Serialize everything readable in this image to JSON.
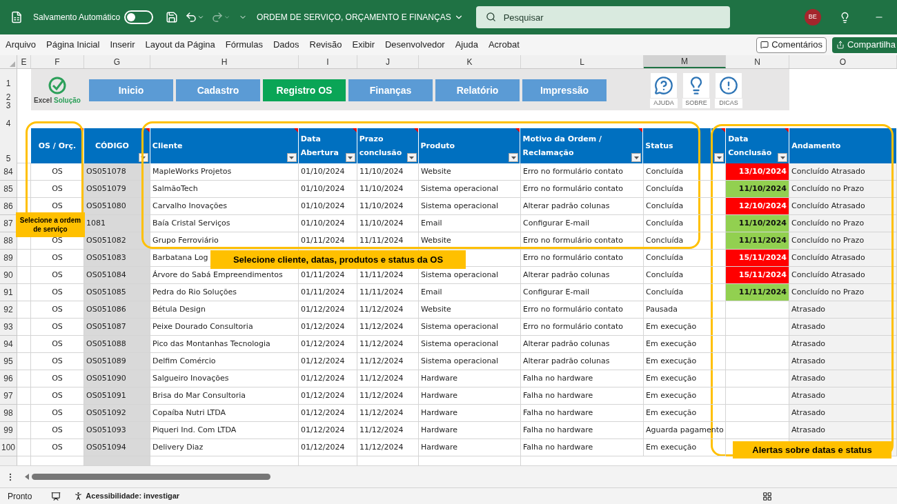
{
  "title_bar": {
    "autosave_label": "Salvamento Automático",
    "autosave_on": false,
    "document_title": "ORDEM DE SERVIÇO, ORÇAMENTO E FINANÇAS",
    "search_placeholder": "Pesquisar",
    "user_initials": "BE"
  },
  "menu": {
    "tabs": [
      "Arquivo",
      "Página Inicial",
      "Inserir",
      "Layout da Página",
      "Fórmulas",
      "Dados",
      "Revisão",
      "Exibir",
      "Desenvolvedor",
      "Ajuda",
      "Acrobat"
    ],
    "comments_button": "Comentários",
    "share_button": "Compartilha"
  },
  "column_headers": [
    {
      "label": "E",
      "selected": false
    },
    {
      "label": "F",
      "selected": false
    },
    {
      "label": "G",
      "selected": false
    },
    {
      "label": "H",
      "selected": false
    },
    {
      "label": "I",
      "selected": false
    },
    {
      "label": "J",
      "selected": false
    },
    {
      "label": "K",
      "selected": false
    },
    {
      "label": "L",
      "selected": false
    },
    {
      "label": "M",
      "selected": true
    },
    {
      "label": "N",
      "selected": false
    },
    {
      "label": "O",
      "selected": false
    }
  ],
  "top_row_numbers": [
    "1",
    "2",
    "3",
    "4",
    "5"
  ],
  "logo": {
    "word_1": "Excel",
    "word_2": "Solução"
  },
  "nav_buttons": [
    {
      "label": "Inicio",
      "selected": false
    },
    {
      "label": "Cadastro",
      "selected": false
    },
    {
      "label": "Registro OS",
      "selected": true
    },
    {
      "label": "Finanças",
      "selected": false
    },
    {
      "label": "Relatório",
      "selected": false
    },
    {
      "label": "Impressão",
      "selected": false
    }
  ],
  "info_buttons": [
    {
      "kind": "help",
      "label": "AJUDA"
    },
    {
      "kind": "about",
      "label": "SOBRE"
    },
    {
      "kind": "tips",
      "label": "DICAS"
    }
  ],
  "table": {
    "columns": [
      {
        "label": "OS / Orç.",
        "filter": false,
        "comment": true
      },
      {
        "label": "CÓDIGO",
        "filter": true,
        "comment": true
      },
      {
        "label": "Cliente",
        "filter": true,
        "comment": true
      },
      {
        "label": "Data Abertura",
        "filter": true,
        "comment": true
      },
      {
        "label": "Prazo conclusão",
        "filter": true,
        "comment": true
      },
      {
        "label": "Produto",
        "filter": true,
        "comment": true
      },
      {
        "label": "Motivo da Ordem / Reclamação",
        "filter": true,
        "comment": true
      },
      {
        "label": "Status",
        "filter": false,
        "comment": false
      },
      {
        "filter": true,
        "comment": true
      },
      {
        "label": "Data Conclusão",
        "filter": true,
        "comment": true
      },
      {
        "label": "Andamento",
        "filter": false,
        "comment": false
      }
    ],
    "rows": [
      {
        "row_number": "84",
        "type": "OS",
        "code": "OS051078",
        "client": "MapleWorks Projetos",
        "opened": "01/10/2024",
        "deadline": "11/10/2024",
        "product": "Website",
        "reason": "Erro no formulário contato",
        "status": "Concluída",
        "completed": "13/10/2024",
        "color": "#ff0000",
        "progress": "Concluído Atrasado"
      },
      {
        "row_number": "85",
        "type": "OS",
        "code": "OS051079",
        "client": "SalmãoTech",
        "opened": "01/10/2024",
        "deadline": "11/10/2024",
        "product": "Sistema operacional",
        "reason": "Erro no formulário contato",
        "status": "Concluída",
        "completed": "11/10/2024",
        "color": "#92d050",
        "progress": "Concluído no Prazo"
      },
      {
        "row_number": "86",
        "type": "OS",
        "code": "OS051080",
        "client": "Carvalho Inovações",
        "opened": "01/10/2024",
        "deadline": "11/10/2024",
        "product": "Sistema operacional",
        "reason": "Alterar padrão colunas",
        "status": "Concluída",
        "completed": "12/10/2024",
        "color": "#ff0000",
        "progress": "Concluído Atrasado"
      },
      {
        "row_number": "87",
        "code": "1081",
        "client": "Baía Cristal Serviços",
        "opened": "01/10/2024",
        "deadline": "11/10/2024",
        "product": "Email",
        "reason": "Configurar E-mail",
        "status": "Concluída",
        "completed": "11/10/2024",
        "color": "#92d050",
        "progress": "Concluído no Prazo"
      },
      {
        "row_number": "88",
        "type": "OS",
        "code": "OS051082",
        "client": "Grupo Ferroviário",
        "opened": "01/11/2024",
        "deadline": "11/11/2024",
        "product": "Website",
        "reason": "Erro no formulário contato",
        "status": "Concluída",
        "completed": "11/11/2024",
        "color": "#92d050",
        "progress": "Concluído no Prazo"
      },
      {
        "row_number": "89",
        "type": "OS",
        "code": "OS051083",
        "client": "Barbatana Log",
        "reason": "Erro no formulário contato",
        "status": "Concluída",
        "completed": "15/11/2024",
        "color": "#ff0000",
        "progress": "Concluído Atrasado"
      },
      {
        "row_number": "90",
        "type": "OS",
        "code": "OS051084",
        "client": "Árvore do Sabá Empreendimentos",
        "opened": "01/11/2024",
        "deadline": "11/11/2024",
        "product": "Sistema operacional",
        "reason": "Alterar padrão colunas",
        "status": "Concluída",
        "completed": "15/11/2024",
        "color": "#ff0000",
        "progress": "Concluído Atrasado"
      },
      {
        "row_number": "91",
        "type": "OS",
        "code": "OS051085",
        "client": "Pedra do Rio Soluções",
        "opened": "01/11/2024",
        "deadline": "11/11/2024",
        "product": "Email",
        "reason": "Configurar E-mail",
        "status": "Concluída",
        "completed": "11/11/2024",
        "color": "#92d050",
        "progress": "Concluído no Prazo"
      },
      {
        "row_number": "92",
        "type": "OS",
        "code": "OS051086",
        "client": "Bétula Design",
        "opened": "01/12/2024",
        "deadline": "11/12/2024",
        "product": "Website",
        "reason": "Erro no formulário contato",
        "status": "Pausada",
        "progress": "Atrasado"
      },
      {
        "row_number": "93",
        "type": "OS",
        "code": "OS051087",
        "client": "Peixe Dourado Consultoria",
        "opened": "01/12/2024",
        "deadline": "11/12/2024",
        "product": "Sistema operacional",
        "reason": "Erro no formulário contato",
        "status": "Em execução",
        "progress": "Atrasado"
      },
      {
        "row_number": "94",
        "type": "OS",
        "code": "OS051088",
        "client": "Pico das Montanhas Tecnologia",
        "opened": "01/12/2024",
        "deadline": "11/12/2024",
        "product": "Sistema operacional",
        "reason": "Alterar padrão colunas",
        "status": "Em execução",
        "progress": "Atrasado"
      },
      {
        "row_number": "95",
        "type": "OS",
        "code": "OS051089",
        "client": "Delfim Comércio",
        "opened": "01/12/2024",
        "deadline": "11/12/2024",
        "product": "Sistema operacional",
        "reason": "Alterar padrão colunas",
        "status": "Em execução",
        "progress": "Atrasado"
      },
      {
        "row_number": "96",
        "type": "OS",
        "code": "OS051090",
        "client": "Salgueiro Inovações",
        "opened": "01/12/2024",
        "deadline": "11/12/2024",
        "product": "Hardware",
        "reason": "Falha no hardware",
        "status": "Em execução",
        "progress": "Atrasado"
      },
      {
        "row_number": "97",
        "type": "OS",
        "code": "OS051091",
        "client": "Brisa do Mar Consultoria",
        "opened": "01/12/2024",
        "deadline": "11/12/2024",
        "product": "Hardware",
        "reason": "Falha no hardware",
        "status": "Em execução",
        "progress": "Atrasado"
      },
      {
        "row_number": "98",
        "type": "OS",
        "code": "OS051092",
        "client": "Copaíba Nutri LTDA",
        "opened": "01/12/2024",
        "deadline": "11/12/2024",
        "product": "Hardware",
        "reason": "Falha no hardware",
        "status": "Em execução",
        "progress": "Atrasado"
      },
      {
        "row_number": "99",
        "type": "OS",
        "code": "OS051093",
        "client": "Piqueri Ind. Com LTDA",
        "opened": "01/12/2024",
        "deadline": "11/12/2024",
        "product": "Hardware",
        "reason": "Falha no hardware",
        "status": "Aguarda pagamento",
        "progress": "Atrasado"
      },
      {
        "row_number": "100",
        "type": "OS",
        "code": "OS051094",
        "client": "Delivery Diaz",
        "opened": "01/12/2024",
        "deadline": "11/12/2024",
        "product": "Hardware",
        "reason": "Falha no hardware",
        "status": "Em execução"
      }
    ]
  },
  "callouts": [
    {
      "kind": "order",
      "text": "Selecione a ordem de serviço"
    },
    {
      "kind": "fields",
      "text": "Selecione cliente, datas, produtos e status da OS"
    },
    {
      "kind": "alerts",
      "text": "Alertas sobre datas e status"
    }
  ],
  "status_bar": {
    "mode": "Pronto",
    "accessibility": "Acessibilidade: investigar"
  }
}
